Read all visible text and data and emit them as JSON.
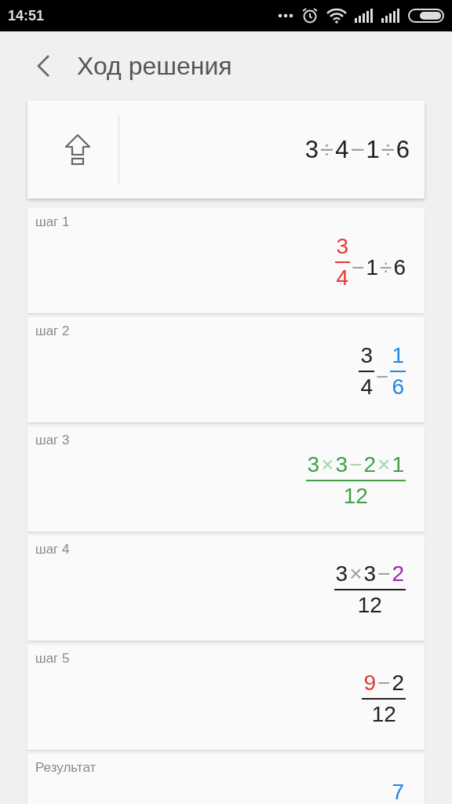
{
  "status_bar": {
    "time": "14:51"
  },
  "header": {
    "title": "Ход решения"
  },
  "input": {
    "expression": [
      {
        "kind": "num",
        "text": "3",
        "color": "#212121"
      },
      {
        "kind": "op",
        "text": "÷",
        "color": "#9e9e9e"
      },
      {
        "kind": "num",
        "text": "4",
        "color": "#212121"
      },
      {
        "kind": "op",
        "text": "−",
        "color": "#9e9e9e"
      },
      {
        "kind": "num",
        "text": "1",
        "color": "#212121"
      },
      {
        "kind": "op",
        "text": "÷",
        "color": "#9e9e9e"
      },
      {
        "kind": "num",
        "text": "6",
        "color": "#212121"
      }
    ]
  },
  "steps": [
    {
      "label": "шаг 1",
      "expression": [
        {
          "kind": "frac",
          "color": "#e53935",
          "numerator": [
            {
              "kind": "num",
              "text": "3",
              "color": "#e53935"
            }
          ],
          "denominator": [
            {
              "kind": "num",
              "text": "4",
              "color": "#e53935"
            }
          ]
        },
        {
          "kind": "op",
          "text": "−",
          "color": "#9e9e9e"
        },
        {
          "kind": "num",
          "text": "1",
          "color": "#212121"
        },
        {
          "kind": "op",
          "text": "÷",
          "color": "#9e9e9e"
        },
        {
          "kind": "num",
          "text": "6",
          "color": "#212121"
        }
      ]
    },
    {
      "label": "шаг 2",
      "expression": [
        {
          "kind": "frac",
          "color": "#212121",
          "numerator": [
            {
              "kind": "num",
              "text": "3",
              "color": "#212121"
            }
          ],
          "denominator": [
            {
              "kind": "num",
              "text": "4",
              "color": "#212121"
            }
          ]
        },
        {
          "kind": "op",
          "text": "−",
          "color": "#9e9e9e"
        },
        {
          "kind": "frac",
          "color": "#1e88e5",
          "numerator": [
            {
              "kind": "num",
              "text": "1",
              "color": "#1e88e5"
            }
          ],
          "denominator": [
            {
              "kind": "num",
              "text": "6",
              "color": "#1e88e5"
            }
          ]
        }
      ]
    },
    {
      "label": "шаг 3",
      "expression": [
        {
          "kind": "frac",
          "color": "#43a047",
          "numerator": [
            {
              "kind": "num",
              "text": "3",
              "color": "#43a047"
            },
            {
              "kind": "op",
              "text": "×",
              "color": "#a5d6a7"
            },
            {
              "kind": "num",
              "text": "3",
              "color": "#43a047"
            },
            {
              "kind": "op",
              "text": "−",
              "color": "#a5d6a7"
            },
            {
              "kind": "num",
              "text": "2",
              "color": "#43a047"
            },
            {
              "kind": "op",
              "text": "×",
              "color": "#a5d6a7"
            },
            {
              "kind": "num",
              "text": "1",
              "color": "#43a047"
            }
          ],
          "denominator": [
            {
              "kind": "num",
              "text": "12",
              "color": "#43a047"
            }
          ]
        }
      ]
    },
    {
      "label": "шаг 4",
      "expression": [
        {
          "kind": "frac",
          "color": "#212121",
          "numerator": [
            {
              "kind": "num",
              "text": "3",
              "color": "#212121"
            },
            {
              "kind": "op",
              "text": "×",
              "color": "#9e9e9e"
            },
            {
              "kind": "num",
              "text": "3",
              "color": "#212121"
            },
            {
              "kind": "op",
              "text": "−",
              "color": "#9e9e9e"
            },
            {
              "kind": "num",
              "text": "2",
              "color": "#9c27b0"
            }
          ],
          "denominator": [
            {
              "kind": "num",
              "text": "12",
              "color": "#212121"
            }
          ]
        }
      ]
    },
    {
      "label": "шаг 5",
      "expression": [
        {
          "kind": "frac",
          "color": "#212121",
          "numerator": [
            {
              "kind": "num",
              "text": "9",
              "color": "#e53935"
            },
            {
              "kind": "op",
              "text": "−",
              "color": "#9e9e9e"
            },
            {
              "kind": "num",
              "text": "2",
              "color": "#212121"
            }
          ],
          "denominator": [
            {
              "kind": "num",
              "text": "12",
              "color": "#212121"
            }
          ]
        }
      ]
    },
    {
      "label": "Результат",
      "expression": [
        {
          "kind": "frac",
          "numerator": [
            {
              "kind": "num",
              "text": "7",
              "color": "#1e88e5"
            }
          ]
        }
      ]
    }
  ]
}
